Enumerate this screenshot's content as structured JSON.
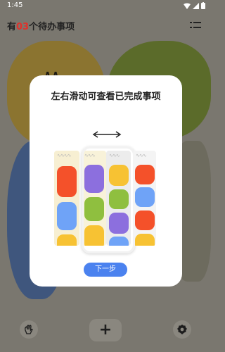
{
  "status_bar": {
    "time": "1:45",
    "icons": [
      "wifi-icon",
      "cell-signal-icon",
      "battery-icon"
    ]
  },
  "header": {
    "title_prefix": "有",
    "title_count": "03",
    "title_suffix": "个待办事项",
    "menu_icon": "list-menu-icon",
    "count_color": "#e0312b"
  },
  "onboarding": {
    "title": "左右滑动可查看已完成事项",
    "swipe_icon": "left-right-arrow-icon",
    "next_label": "下一步",
    "accent": "#4b82ef"
  },
  "bottom_bar": {
    "left_icon": "wave-hand-icon",
    "center_icon": "plus-icon",
    "center_label": "+",
    "right_icon": "settings-gear-icon"
  },
  "colors": {
    "scrim": "#7a776f",
    "blob_yellow": "#8b7430",
    "blob_green": "#5b6b2a",
    "blob_blue": "#3f567d",
    "tile_red": "#f4512a",
    "tile_blue": "#6fa3f7",
    "tile_yellow": "#f7c233",
    "tile_purple": "#8c6fde",
    "tile_green": "#8fbf3f"
  }
}
